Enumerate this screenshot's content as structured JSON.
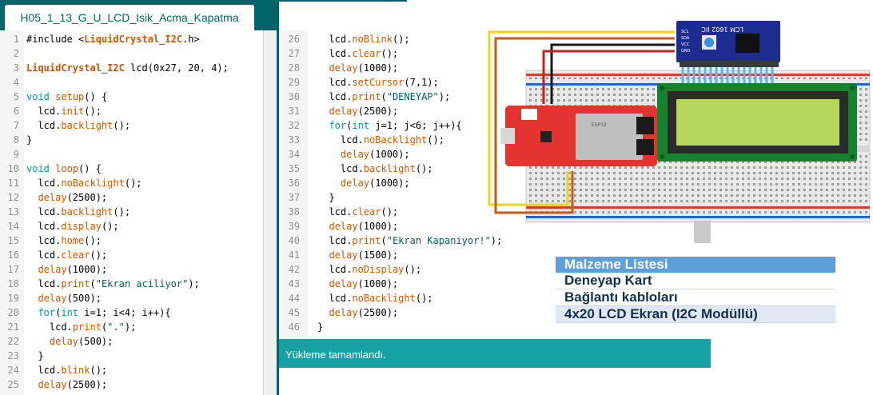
{
  "editor": {
    "tab_label": "H05_1_13_G_U_LCD_Isik_Acma_Kapatma",
    "left_lines": [
      {
        "n": "1",
        "t": "#include <LiquidCrystal_I2C.h>"
      },
      {
        "n": "2",
        "t": ""
      },
      {
        "n": "3",
        "t": "LiquidCrystal_I2C lcd(0x27, 20, 4);"
      },
      {
        "n": "4",
        "t": ""
      },
      {
        "n": "5",
        "t": "void setup() {"
      },
      {
        "n": "6",
        "t": "  lcd.init();"
      },
      {
        "n": "7",
        "t": "  lcd.backlight();"
      },
      {
        "n": "8",
        "t": "}"
      },
      {
        "n": "9",
        "t": ""
      },
      {
        "n": "10",
        "t": "void loop() {"
      },
      {
        "n": "11",
        "t": "  lcd.noBacklight();"
      },
      {
        "n": "12",
        "t": "  delay(2500);"
      },
      {
        "n": "13",
        "t": "  lcd.backlight();"
      },
      {
        "n": "14",
        "t": "  lcd.display();"
      },
      {
        "n": "15",
        "t": "  lcd.home();"
      },
      {
        "n": "16",
        "t": "  lcd.clear();"
      },
      {
        "n": "17",
        "t": "  delay(1000);"
      },
      {
        "n": "18",
        "t": "  lcd.print(\"Ekran aciliyor\");"
      },
      {
        "n": "19",
        "t": "  delay(500);"
      },
      {
        "n": "20",
        "t": "  for(int i=1; i<4; i++){"
      },
      {
        "n": "21",
        "t": "    lcd.print(\".\");"
      },
      {
        "n": "22",
        "t": "    delay(500);"
      },
      {
        "n": "23",
        "t": "  }"
      },
      {
        "n": "24",
        "t": "  lcd.blink();"
      },
      {
        "n": "25",
        "t": "  delay(2500);"
      }
    ],
    "right_lines": [
      {
        "n": "26",
        "t": "  lcd.noBlink();"
      },
      {
        "n": "27",
        "t": "  lcd.clear();"
      },
      {
        "n": "28",
        "t": "  delay(1000);"
      },
      {
        "n": "29",
        "t": "  lcd.setCursor(7,1);"
      },
      {
        "n": "30",
        "t": "  lcd.print(\"DENEYAP\");"
      },
      {
        "n": "31",
        "t": "  delay(2500);"
      },
      {
        "n": "32",
        "t": "  for(int j=1; j<6; j++){"
      },
      {
        "n": "33",
        "t": "    lcd.noBacklight();"
      },
      {
        "n": "34",
        "t": "    delay(1000);"
      },
      {
        "n": "35",
        "t": "    lcd.backlight();"
      },
      {
        "n": "36",
        "t": "    delay(1000);"
      },
      {
        "n": "37",
        "t": "  }"
      },
      {
        "n": "38",
        "t": "  lcd.clear();"
      },
      {
        "n": "39",
        "t": "  delay(1000);"
      },
      {
        "n": "40",
        "t": "  lcd.print(\"Ekran Kapaniyor!\");"
      },
      {
        "n": "41",
        "t": "  delay(1500);"
      },
      {
        "n": "42",
        "t": "  lcd.noDisplay();"
      },
      {
        "n": "43",
        "t": "  delay(1000);"
      },
      {
        "n": "44",
        "t": "  lcd.noBacklight();"
      },
      {
        "n": "45",
        "t": "  delay(2500);"
      },
      {
        "n": "46",
        "t": "}"
      }
    ],
    "status_message": "Yükleme tamamlandı."
  },
  "diagram": {
    "module_label": "LCM 1602 IIC",
    "pin_labels": [
      "SCL",
      "SDA",
      "VCC",
      "GND"
    ],
    "board_chip_label": "ESP32"
  },
  "materials": {
    "title": "Malzeme Listesi",
    "items": [
      "Deneyap Kart",
      "Bağlantı kabloları",
      "4x20 LCD Ekran (I2C Modüllü)"
    ]
  },
  "colors": {
    "teal_dark": "#006468",
    "teal_light": "#17a1a5",
    "keyword": "#00979c",
    "function": "#d35400",
    "lcd_green": "#b7d65c",
    "board_red": "#e3342f",
    "module_blue": "#1d2c8f",
    "list_header": "#5d9fd6"
  },
  "icons": [
    "lcd-display-icon",
    "microcontroller-board-icon",
    "breadboard-icon"
  ]
}
